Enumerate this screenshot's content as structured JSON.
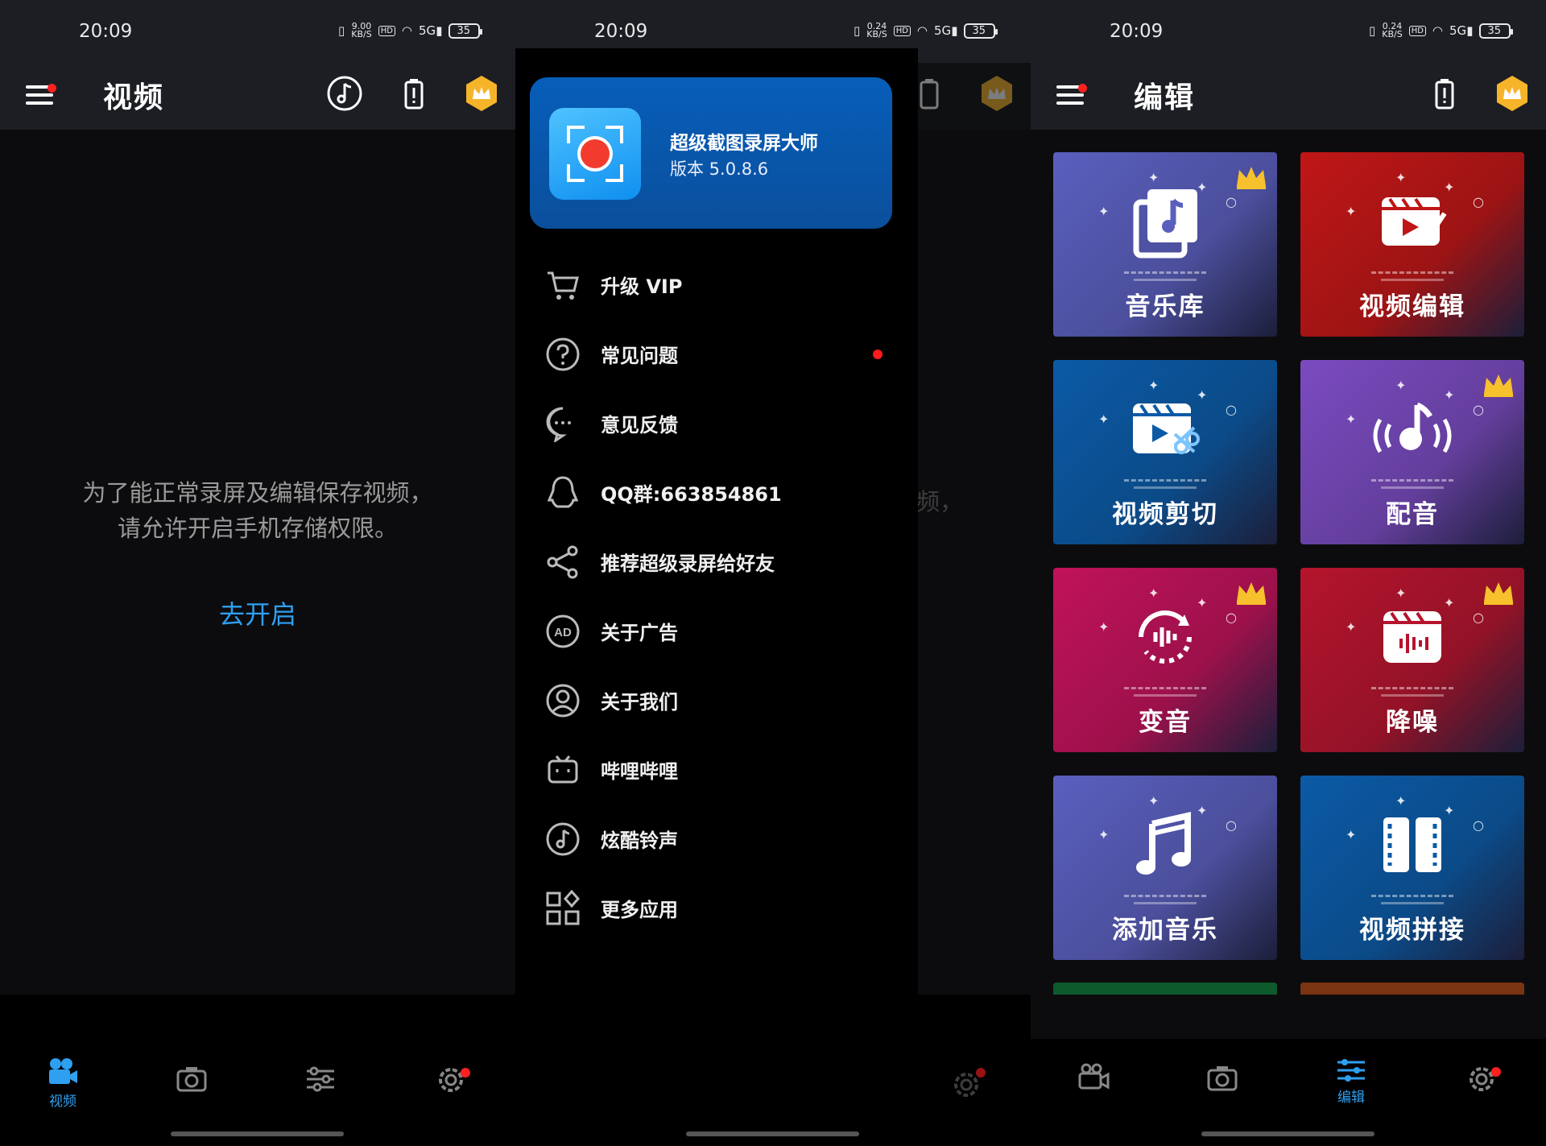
{
  "colors": {
    "accent": "#2f9ff0",
    "badge_red": "#ff2020",
    "crown_gold": "#f6c12c"
  },
  "screens": [
    {
      "status": {
        "time": "20:09",
        "speed_top": "9.00",
        "speed_unit": "KB/S",
        "hd": "HD",
        "signal": "5G",
        "battery": "35"
      },
      "appbar": {
        "title": "视频"
      },
      "permission": {
        "line1": "为了能正常录屏及编辑保存视频，",
        "line2": "请允许开启手机存储权限。",
        "action": "去开启"
      },
      "nav": [
        {
          "label": "视频",
          "icon": "video-camera-icon"
        },
        {
          "label": "",
          "icon": "camera-icon"
        },
        {
          "label": "",
          "icon": "sliders-icon"
        },
        {
          "label": "",
          "icon": "gear-icon"
        }
      ]
    },
    {
      "status": {
        "time": "20:09",
        "speed_top": "0.24",
        "speed_unit": "KB/S",
        "hd": "HD",
        "signal": "5G",
        "battery": "35"
      },
      "behind_text": "频，",
      "drawer": {
        "app_name": "超级截图录屏大师",
        "version": "版本 5.0.8.6",
        "items": [
          {
            "label": "升级 VIP",
            "icon": "cart-icon"
          },
          {
            "label": "常见问题",
            "icon": "question-icon"
          },
          {
            "label": "意见反馈",
            "icon": "chat-icon"
          },
          {
            "label": "QQ群:663854861",
            "icon": "qq-icon"
          },
          {
            "label": "推荐超级录屏给好友",
            "icon": "share-icon"
          },
          {
            "label": "关于广告",
            "icon": "ad-icon"
          },
          {
            "label": "关于我们",
            "icon": "user-icon"
          },
          {
            "label": "哔哩哔哩",
            "icon": "bilibili-icon"
          },
          {
            "label": "炫酷铃声",
            "icon": "music-note-icon"
          },
          {
            "label": "更多应用",
            "icon": "apps-icon"
          }
        ]
      }
    },
    {
      "status": {
        "time": "20:09",
        "speed_top": "0.24",
        "speed_unit": "KB/S",
        "hd": "HD",
        "signal": "5G",
        "battery": "35"
      },
      "appbar": {
        "title": "编辑"
      },
      "tiles": [
        {
          "label": "音乐库",
          "icon": "music-library-icon",
          "vip": true,
          "color": "#5a5fbe"
        },
        {
          "label": "视频编辑",
          "icon": "video-edit-icon",
          "vip": false,
          "color": "#c01616"
        },
        {
          "label": "视频剪切",
          "icon": "video-cut-icon",
          "vip": false,
          "color": "#0b5aa6"
        },
        {
          "label": "配音",
          "icon": "dubbing-icon",
          "vip": true,
          "color": "#7a4bc0"
        },
        {
          "label": "变音",
          "icon": "voice-change-icon",
          "vip": true,
          "color": "#c1125a"
        },
        {
          "label": "降噪",
          "icon": "noise-reduce-icon",
          "vip": true,
          "color": "#b5142d"
        },
        {
          "label": "添加音乐",
          "icon": "add-music-icon",
          "vip": false,
          "color": "#5a5fbe"
        },
        {
          "label": "视频拼接",
          "icon": "video-join-icon",
          "vip": false,
          "color": "#0b5aa6"
        }
      ],
      "nav": [
        {
          "label": "",
          "icon": "video-camera-icon"
        },
        {
          "label": "",
          "icon": "camera-icon"
        },
        {
          "label": "编辑",
          "icon": "sliders-icon"
        },
        {
          "label": "",
          "icon": "gear-icon"
        }
      ]
    }
  ]
}
